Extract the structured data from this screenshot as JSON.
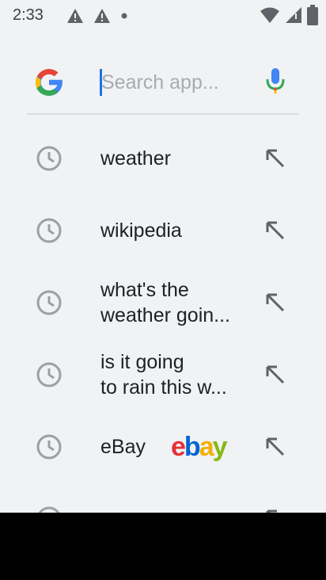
{
  "status_bar": {
    "time": "2:33",
    "left_icons": [
      "warning-icon",
      "warning-icon",
      "dot-icon"
    ],
    "right_icons": [
      "wifi-icon",
      "cell-signal-icon",
      "battery-icon"
    ]
  },
  "search": {
    "placeholder": "Search app...",
    "value": "",
    "logo": "google-g-icon",
    "voice_icon": "mic-icon"
  },
  "suggestions": [
    {
      "text": "weather",
      "icon": "clock-icon",
      "action_icon": "fill-query-arrow-icon"
    },
    {
      "text": "wikipedia",
      "icon": "clock-icon",
      "action_icon": "fill-query-arrow-icon"
    },
    {
      "text_lines": [
        "what's the",
        "weather goin..."
      ],
      "icon": "clock-icon",
      "action_icon": "fill-query-arrow-icon"
    },
    {
      "text_lines": [
        "is it going",
        "to rain this w..."
      ],
      "icon": "clock-icon",
      "action_icon": "fill-query-arrow-icon"
    },
    {
      "text": "eBay",
      "icon": "clock-icon",
      "brand_logo": {
        "letters": [
          "e",
          "b",
          "a",
          "y"
        ],
        "colors": [
          "#e53238",
          "#0064d2",
          "#f5af02",
          "#86b817"
        ]
      },
      "action_icon": "fill-query-arrow-icon"
    }
  ],
  "colors": {
    "background": "#f1f2f4",
    "accent": "#1a73e8",
    "icon_gray": "#70757a",
    "nav_bar": "#000000"
  }
}
